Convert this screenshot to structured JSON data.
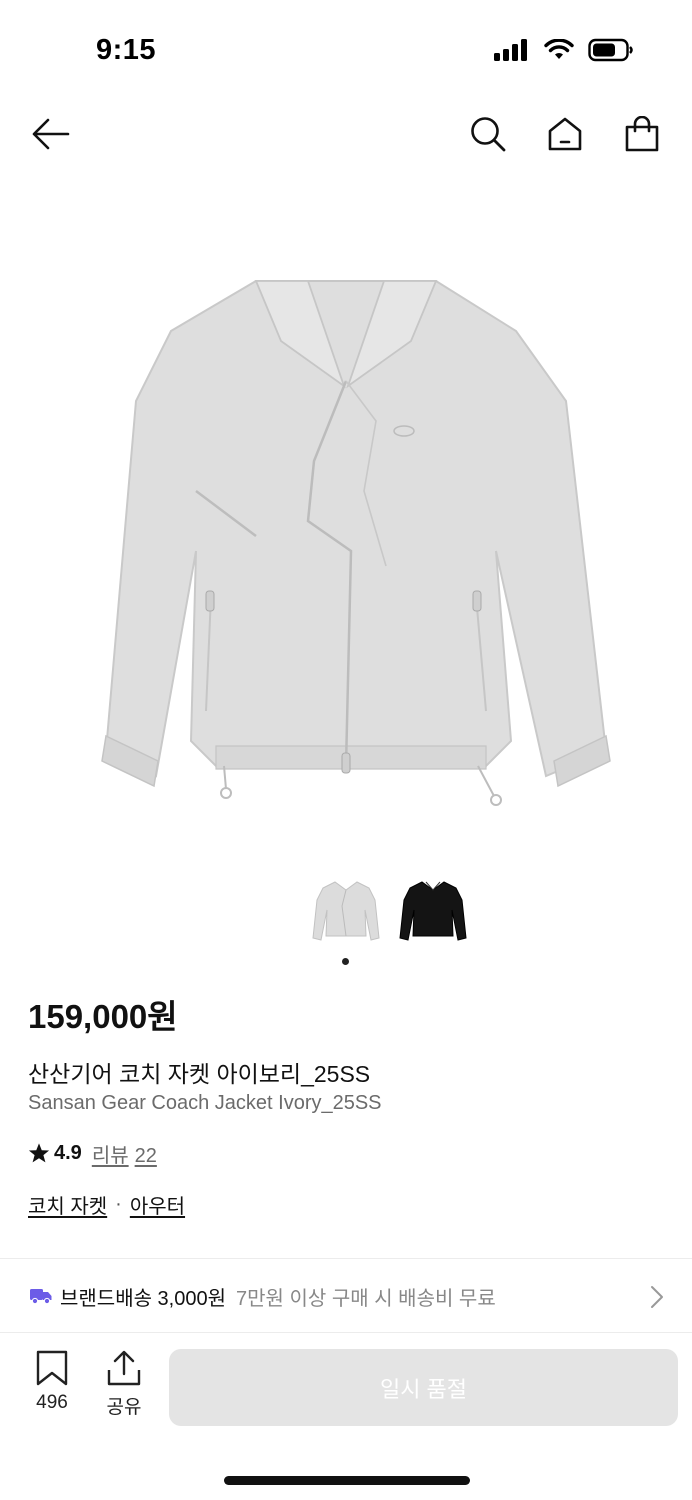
{
  "status_bar": {
    "time": "9:15",
    "icons": [
      "cellular-signal-icon",
      "wifi-icon",
      "battery-icon"
    ]
  },
  "nav": {
    "icons": [
      "back-arrow-icon",
      "search-icon",
      "home-icon",
      "shopping-bag-icon"
    ]
  },
  "product": {
    "colors": {
      "ivory": "#dcdcdc",
      "black": "#141414"
    },
    "thumbnails_count": 2,
    "selected_thumbnail_index": 1,
    "price": "159,000원",
    "name_ko": "산산기어 코치 자켓 아이보리_25SS",
    "name_en": "Sansan Gear Coach Jacket Ivory_25SS",
    "rating": "4.9",
    "review_label": "리뷰",
    "review_count": "22",
    "category_1": "코치 자켓",
    "category_separator": "·",
    "category_2": "아우터"
  },
  "shipping": {
    "icon": "truck-icon",
    "icon_color": "#6c5ce7",
    "main": "브랜드배송 3,000원",
    "sub": "7만원 이상 구매 시 배송비 무료"
  },
  "bottom": {
    "bookmark_count": "496",
    "share_label": "공유",
    "soldout_label": "일시 품절"
  }
}
